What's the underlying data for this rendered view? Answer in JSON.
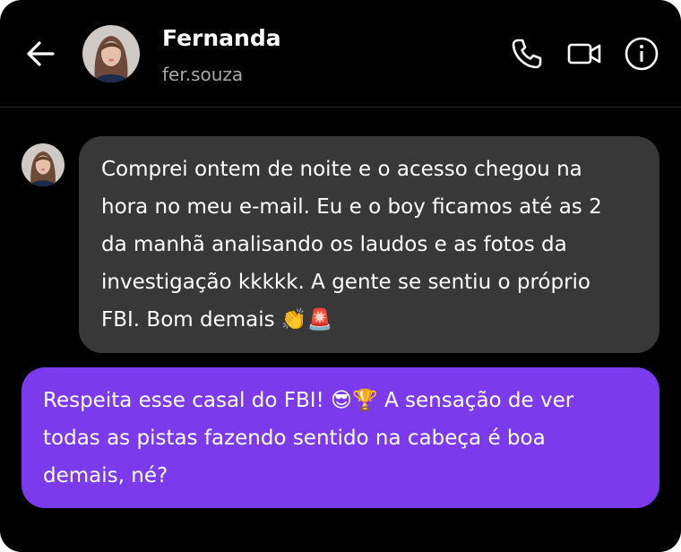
{
  "header": {
    "contact_name": "Fernanda",
    "contact_handle": "fer.souza",
    "icons": {
      "back": "arrow-left-icon",
      "call": "phone-icon",
      "video": "video-camera-icon",
      "info": "info-icon"
    }
  },
  "messages": [
    {
      "direction": "incoming",
      "lines": [
        "Comprei ontem de noite e o acesso chegou na",
        "hora no meu e-mail. Eu e o boy ficamos até as 2",
        "da manhã analisando os laudos e as fotos da",
        "investigação kkkkk. A gente se sentiu o próprio",
        "FBI. Bom demais 👏🚨"
      ]
    },
    {
      "direction": "outgoing",
      "lines": [
        "Respeita esse casal do FBI! 😎🏆 A sensação de ver",
        "todas as pistas fazendo sentido na cabeça é boa",
        "demais, né?"
      ]
    }
  ],
  "colors": {
    "background": "#000000",
    "incoming_bubble": "#383838",
    "outgoing_bubble": "#7c3aed",
    "secondary_text": "#a8a8a8",
    "text": "#ffffff"
  }
}
